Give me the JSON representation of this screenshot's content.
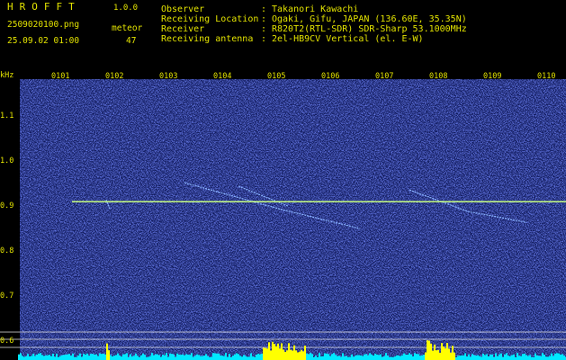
{
  "header": {
    "logo": "HROFFT",
    "version": "1.0.0",
    "filename": "2509020100.png",
    "datetime": "25.09.02 01:00",
    "meteor_label": "meteor",
    "meteor_count": "47",
    "info": [
      {
        "label": "Observer",
        "value": "Takanori Kawachi"
      },
      {
        "label": "Receiving Location",
        "value": "Ogaki, Gifu, JAPAN (136.60E, 35.35N)"
      },
      {
        "label": "Receiver",
        "value": "R820T2(RTL-SDR) SDR-Sharp 53.1000MHz"
      },
      {
        "label": "Receiving antenna",
        "value": "2el-HB9CV Vertical (el. E-W)"
      }
    ]
  },
  "spectrogram": {
    "y_unit": "kHz",
    "x_ticks": [
      "0101",
      "0102",
      "0103",
      "0104",
      "0105",
      "0106",
      "0107",
      "0108",
      "0109",
      "0110"
    ],
    "y_ticks": [
      "1.1",
      "1.0",
      "0.9",
      "0.8",
      "0.7",
      "0.6"
    ],
    "y_values": [
      1.1,
      1.0,
      0.9,
      0.8,
      0.7,
      0.6
    ],
    "carrier_khz": 0.91,
    "colors": {
      "background": "#101a64",
      "carrier": "#c8ff80",
      "meteor": "#8ab4ff",
      "meter": "#00e8ff",
      "peak": "#ffff00",
      "text": "#e4e400"
    }
  }
}
